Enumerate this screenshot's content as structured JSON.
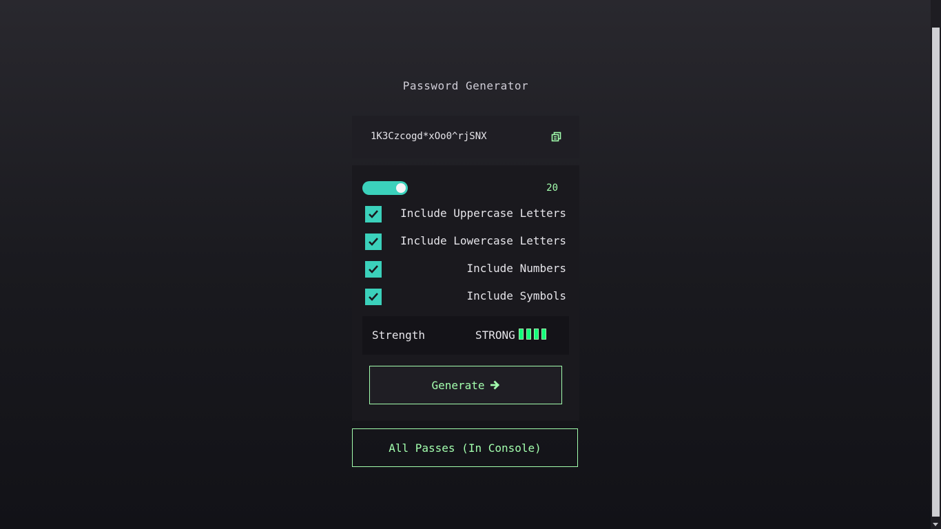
{
  "app": {
    "title": "Password Generator"
  },
  "password": {
    "value": "1K3Czcogd*xOo0^rjSNX",
    "copy_icon": "copy-icon"
  },
  "length": {
    "value": "20"
  },
  "options": [
    {
      "label": "Include Uppercase Letters",
      "checked": true
    },
    {
      "label": "Include Lowercase Letters",
      "checked": true
    },
    {
      "label": "Include Numbers",
      "checked": true
    },
    {
      "label": "Include Symbols",
      "checked": true
    }
  ],
  "strength": {
    "label": "Strength",
    "value": "STRONG",
    "bars_filled": 4,
    "bars_total": 4
  },
  "buttons": {
    "generate_label": "Generate",
    "generate_icon": "arrow-right-icon",
    "all_passes_label": "All Passes (In Console)"
  },
  "colors": {
    "accent": "#a3ffae",
    "teal": "#3bd1bb",
    "bar_fill": "#12ff7a"
  }
}
